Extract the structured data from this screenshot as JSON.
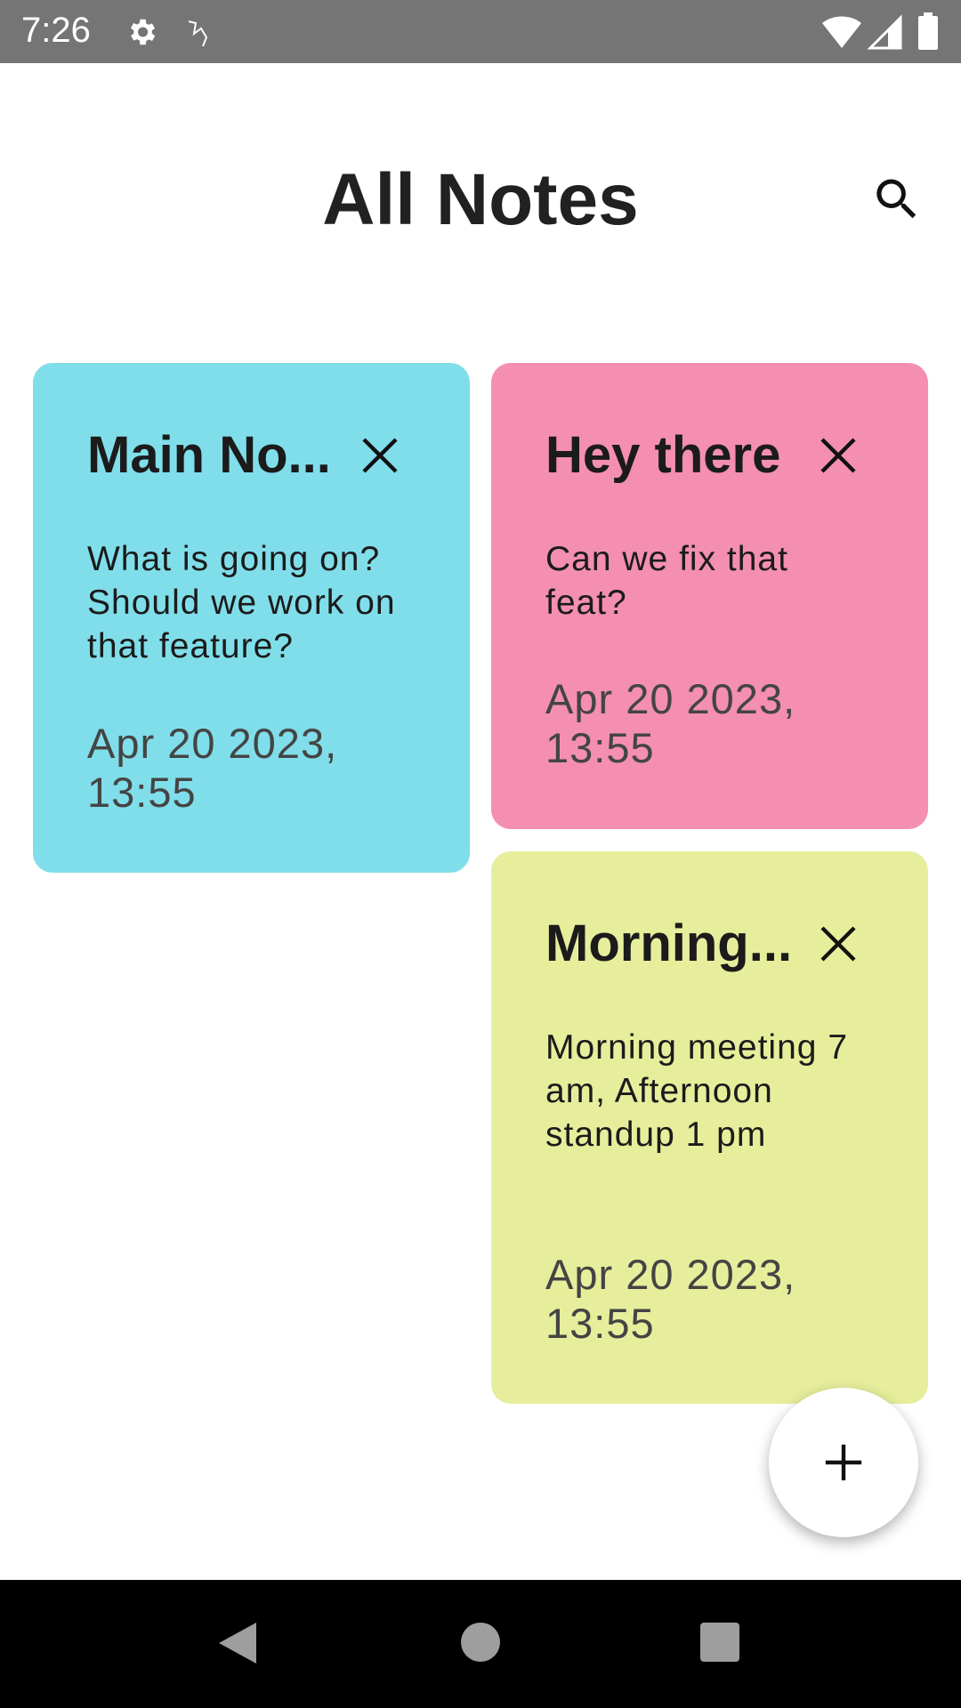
{
  "status_bar": {
    "time": "7:26",
    "icons": [
      "settings-icon",
      "app-notification-icon",
      "wifi-icon",
      "signal-icon",
      "battery-icon"
    ]
  },
  "header": {
    "title": "All Notes",
    "search_icon": "search-icon"
  },
  "notes": [
    {
      "title": "Main No...",
      "body": "What is going on? Should we work on that feature?",
      "date": "Apr 20 2023, 13:55",
      "color": "#80deea"
    },
    {
      "title": "Hey there",
      "body": "Can we fix that feat?",
      "date": "Apr 20 2023, 13:55",
      "color": "#f48fb1"
    },
    {
      "title": "Morning...",
      "body": "Morning meeting 7 am, Afternoon standup 1 pm",
      "date": "Apr 20 2023, 13:55",
      "color": "#e6ee9c"
    }
  ],
  "fab": {
    "icon": "plus-icon"
  },
  "nav_bar": {
    "icons": [
      "back-icon",
      "home-icon",
      "recents-icon"
    ]
  }
}
